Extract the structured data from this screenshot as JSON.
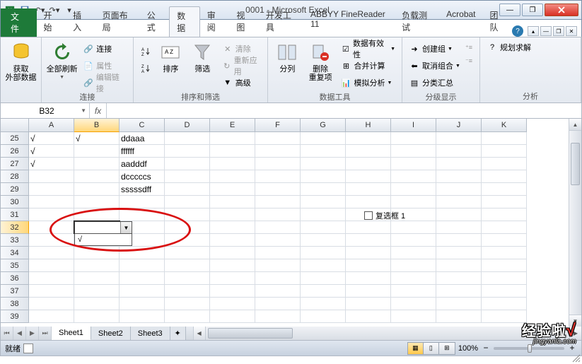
{
  "window": {
    "title": "0001 - Microsoft Excel"
  },
  "ribbon": {
    "file_tab": "文件",
    "tabs": [
      "开始",
      "插入",
      "页面布局",
      "公式",
      "数据",
      "审阅",
      "视图",
      "开发工具",
      "ABBYY FineReader 11",
      "负载测试",
      "Acrobat",
      "团队"
    ],
    "active_tab_index": 4,
    "groups": {
      "get_external": {
        "label": "获取\n外部数据"
      },
      "connections": {
        "label": "连接",
        "refresh": "全部刷新",
        "conn": "连接",
        "props": "属性",
        "editlinks": "编辑链接"
      },
      "sort_filter": {
        "label": "排序和筛选",
        "sort": "排序",
        "filter": "筛选",
        "clear": "清除",
        "reapply": "重新应用",
        "advanced": "高级"
      },
      "data_tools": {
        "label": "数据工具",
        "t2c": "分列",
        "remdup": "删除\n重复项",
        "dv": "数据有效性",
        "consol": "合并计算",
        "whatif": "模拟分析"
      },
      "outline": {
        "label": "分级显示",
        "group": "创建组",
        "ungroup": "取消组合",
        "subtotal": "分类汇总"
      },
      "analysis": {
        "label": "分析",
        "solver": "规划求解"
      }
    }
  },
  "namebox": "B32",
  "formula": "",
  "columns": [
    "A",
    "B",
    "C",
    "D",
    "E",
    "F",
    "G",
    "H",
    "I",
    "J",
    "K"
  ],
  "rows": [
    25,
    26,
    27,
    28,
    29,
    30,
    31,
    32,
    33,
    34,
    35,
    36,
    37,
    38,
    39
  ],
  "active_cell": {
    "row": 32,
    "col": "B"
  },
  "cell_data": {
    "25": {
      "A": "√",
      "B": "√",
      "C": "ddaaa"
    },
    "26": {
      "A": "√",
      "C": "ffffff"
    },
    "27": {
      "A": "√",
      "C": "aadddf"
    },
    "28": {
      "C": "dcccccs"
    },
    "29": {
      "C": "sssssdff"
    }
  },
  "dropdown": {
    "option1": "√"
  },
  "checkbox": {
    "label": "复选框 1"
  },
  "sheets": [
    "Sheet1",
    "Sheet2",
    "Sheet3"
  ],
  "active_sheet_index": 0,
  "status": {
    "ready": "就绪",
    "zoom": "100%"
  },
  "watermark": {
    "main": "经验啦",
    "sub": "jingyanla.com"
  }
}
